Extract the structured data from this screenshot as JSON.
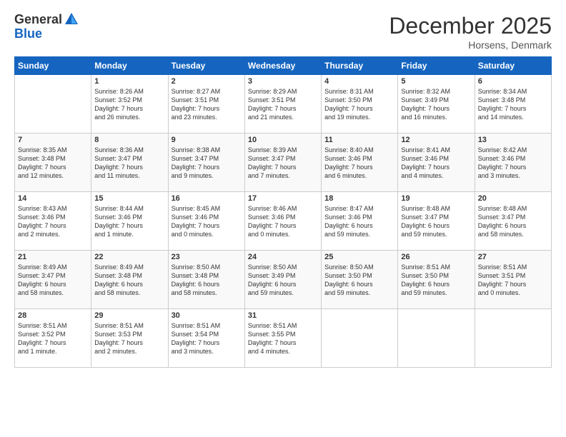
{
  "logo": {
    "general": "General",
    "blue": "Blue"
  },
  "title": "December 2025",
  "location": "Horsens, Denmark",
  "weekdays": [
    "Sunday",
    "Monday",
    "Tuesday",
    "Wednesday",
    "Thursday",
    "Friday",
    "Saturday"
  ],
  "weeks": [
    [
      {
        "day": "",
        "info": ""
      },
      {
        "day": "1",
        "info": "Sunrise: 8:26 AM\nSunset: 3:52 PM\nDaylight: 7 hours\nand 26 minutes."
      },
      {
        "day": "2",
        "info": "Sunrise: 8:27 AM\nSunset: 3:51 PM\nDaylight: 7 hours\nand 23 minutes."
      },
      {
        "day": "3",
        "info": "Sunrise: 8:29 AM\nSunset: 3:51 PM\nDaylight: 7 hours\nand 21 minutes."
      },
      {
        "day": "4",
        "info": "Sunrise: 8:31 AM\nSunset: 3:50 PM\nDaylight: 7 hours\nand 19 minutes."
      },
      {
        "day": "5",
        "info": "Sunrise: 8:32 AM\nSunset: 3:49 PM\nDaylight: 7 hours\nand 16 minutes."
      },
      {
        "day": "6",
        "info": "Sunrise: 8:34 AM\nSunset: 3:48 PM\nDaylight: 7 hours\nand 14 minutes."
      }
    ],
    [
      {
        "day": "7",
        "info": "Sunrise: 8:35 AM\nSunset: 3:48 PM\nDaylight: 7 hours\nand 12 minutes."
      },
      {
        "day": "8",
        "info": "Sunrise: 8:36 AM\nSunset: 3:47 PM\nDaylight: 7 hours\nand 11 minutes."
      },
      {
        "day": "9",
        "info": "Sunrise: 8:38 AM\nSunset: 3:47 PM\nDaylight: 7 hours\nand 9 minutes."
      },
      {
        "day": "10",
        "info": "Sunrise: 8:39 AM\nSunset: 3:47 PM\nDaylight: 7 hours\nand 7 minutes."
      },
      {
        "day": "11",
        "info": "Sunrise: 8:40 AM\nSunset: 3:46 PM\nDaylight: 7 hours\nand 6 minutes."
      },
      {
        "day": "12",
        "info": "Sunrise: 8:41 AM\nSunset: 3:46 PM\nDaylight: 7 hours\nand 4 minutes."
      },
      {
        "day": "13",
        "info": "Sunrise: 8:42 AM\nSunset: 3:46 PM\nDaylight: 7 hours\nand 3 minutes."
      }
    ],
    [
      {
        "day": "14",
        "info": "Sunrise: 8:43 AM\nSunset: 3:46 PM\nDaylight: 7 hours\nand 2 minutes."
      },
      {
        "day": "15",
        "info": "Sunrise: 8:44 AM\nSunset: 3:46 PM\nDaylight: 7 hours\nand 1 minute."
      },
      {
        "day": "16",
        "info": "Sunrise: 8:45 AM\nSunset: 3:46 PM\nDaylight: 7 hours\nand 0 minutes."
      },
      {
        "day": "17",
        "info": "Sunrise: 8:46 AM\nSunset: 3:46 PM\nDaylight: 7 hours\nand 0 minutes."
      },
      {
        "day": "18",
        "info": "Sunrise: 8:47 AM\nSunset: 3:46 PM\nDaylight: 6 hours\nand 59 minutes."
      },
      {
        "day": "19",
        "info": "Sunrise: 8:48 AM\nSunset: 3:47 PM\nDaylight: 6 hours\nand 59 minutes."
      },
      {
        "day": "20",
        "info": "Sunrise: 8:48 AM\nSunset: 3:47 PM\nDaylight: 6 hours\nand 58 minutes."
      }
    ],
    [
      {
        "day": "21",
        "info": "Sunrise: 8:49 AM\nSunset: 3:47 PM\nDaylight: 6 hours\nand 58 minutes."
      },
      {
        "day": "22",
        "info": "Sunrise: 8:49 AM\nSunset: 3:48 PM\nDaylight: 6 hours\nand 58 minutes."
      },
      {
        "day": "23",
        "info": "Sunrise: 8:50 AM\nSunset: 3:48 PM\nDaylight: 6 hours\nand 58 minutes."
      },
      {
        "day": "24",
        "info": "Sunrise: 8:50 AM\nSunset: 3:49 PM\nDaylight: 6 hours\nand 59 minutes."
      },
      {
        "day": "25",
        "info": "Sunrise: 8:50 AM\nSunset: 3:50 PM\nDaylight: 6 hours\nand 59 minutes."
      },
      {
        "day": "26",
        "info": "Sunrise: 8:51 AM\nSunset: 3:50 PM\nDaylight: 6 hours\nand 59 minutes."
      },
      {
        "day": "27",
        "info": "Sunrise: 8:51 AM\nSunset: 3:51 PM\nDaylight: 7 hours\nand 0 minutes."
      }
    ],
    [
      {
        "day": "28",
        "info": "Sunrise: 8:51 AM\nSunset: 3:52 PM\nDaylight: 7 hours\nand 1 minute."
      },
      {
        "day": "29",
        "info": "Sunrise: 8:51 AM\nSunset: 3:53 PM\nDaylight: 7 hours\nand 2 minutes."
      },
      {
        "day": "30",
        "info": "Sunrise: 8:51 AM\nSunset: 3:54 PM\nDaylight: 7 hours\nand 3 minutes."
      },
      {
        "day": "31",
        "info": "Sunrise: 8:51 AM\nSunset: 3:55 PM\nDaylight: 7 hours\nand 4 minutes."
      },
      {
        "day": "",
        "info": ""
      },
      {
        "day": "",
        "info": ""
      },
      {
        "day": "",
        "info": ""
      }
    ]
  ]
}
